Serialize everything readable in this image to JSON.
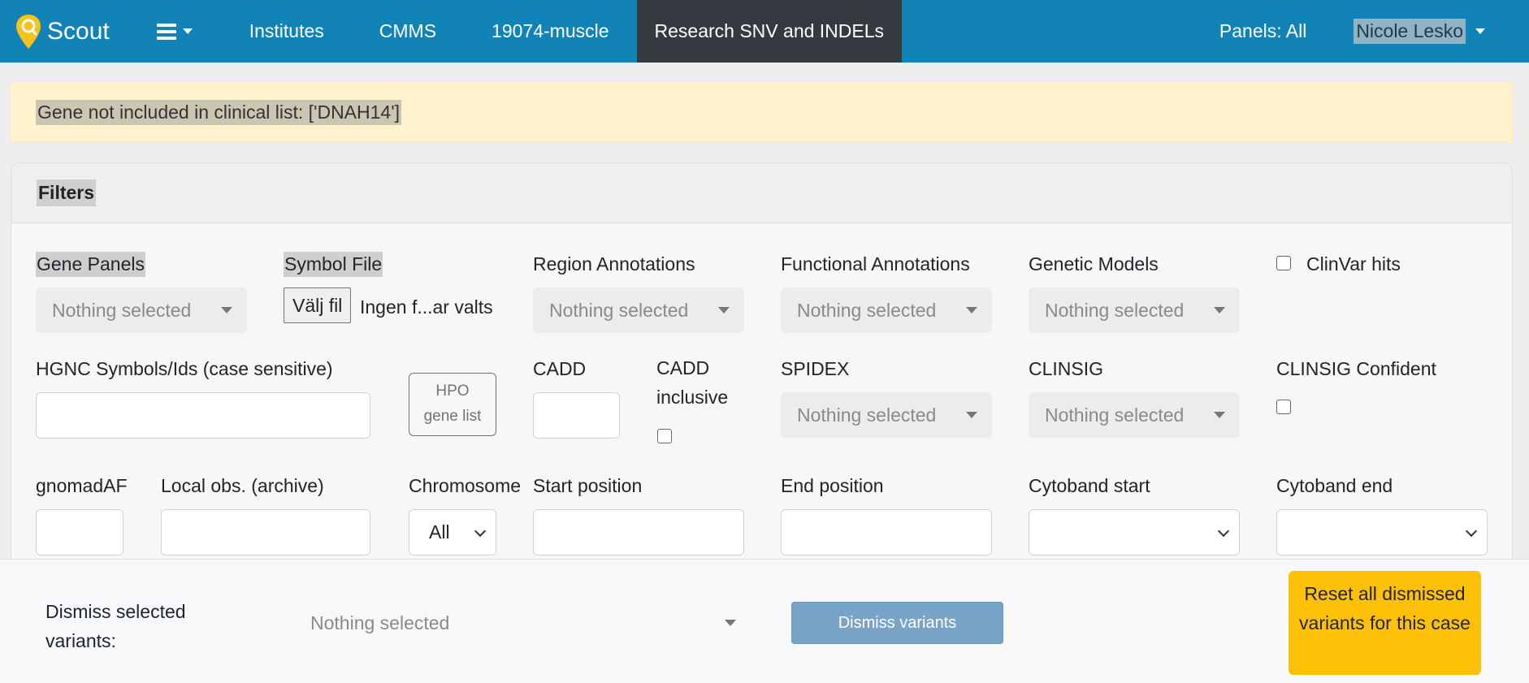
{
  "navbar": {
    "brand": "Scout",
    "links": [
      "Institutes",
      "CMMS",
      "19074-muscle",
      "Research SNV and INDELs"
    ],
    "active_link": "Research SNV and INDELs",
    "panels": "Panels: All",
    "user": "Nicole Lesko",
    "color": "#1283b7"
  },
  "alert": {
    "text": "Gene not included in clinical list: ['DNAH14']",
    "color": "#fff3cd"
  },
  "filters": {
    "title": "Filters",
    "gene_panels": {
      "label": "Gene Panels",
      "placeholder": "Nothing selected"
    },
    "symbol_file": {
      "label": "Symbol File",
      "button": "Välj fil",
      "status": "Ingen f...ar valts"
    },
    "region_annotations": {
      "label": "Region Annotations",
      "placeholder": "Nothing selected"
    },
    "functional_annotations": {
      "label": "Functional Annotations",
      "placeholder": "Nothing selected"
    },
    "genetic_models": {
      "label": "Genetic Models",
      "placeholder": "Nothing selected"
    },
    "clinvar_hits": {
      "label": "ClinVar hits",
      "checked": false
    },
    "hgnc": {
      "label": "HGNC Symbols/Ids (case sensitive)",
      "value": ""
    },
    "hpo_button": {
      "line1": "HPO",
      "line2": "gene list"
    },
    "cadd": {
      "label": "CADD",
      "value": ""
    },
    "cadd_inclusive": {
      "line1": "CADD",
      "line2": "inclusive",
      "checked": false
    },
    "spidex": {
      "label": "SPIDEX",
      "placeholder": "Nothing selected"
    },
    "clinsig": {
      "label": "CLINSIG",
      "placeholder": "Nothing selected"
    },
    "clinsig_confident": {
      "label": "CLINSIG Confident",
      "checked": false
    },
    "gnomad_af": {
      "label": "gnomadAF",
      "value": ""
    },
    "local_obs": {
      "label": "Local obs. (archive)",
      "value": ""
    },
    "chromosome": {
      "label": "Chromosome",
      "value": "All"
    },
    "start_position": {
      "label": "Start position",
      "value": ""
    },
    "end_position": {
      "label": "End position",
      "value": ""
    },
    "cytoband_start": {
      "label": "Cytoband start",
      "value": ""
    },
    "cytoband_end": {
      "label": "Cytoband end",
      "value": ""
    }
  },
  "bottom": {
    "dismiss_label": "Dismiss selected variants:",
    "dismiss_placeholder": "Nothing selected",
    "dismiss_button": "Dismiss variants",
    "reset_button": "Reset all dismissed variants for this case",
    "reset_color": "#ffc107"
  }
}
